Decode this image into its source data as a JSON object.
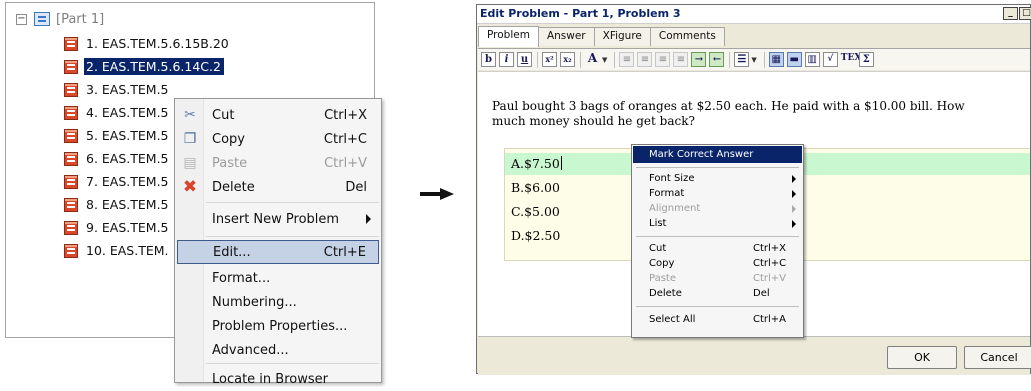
{
  "tree": {
    "root_label": "[Part 1]",
    "items": [
      {
        "label": "1. EAS.TEM.5.6.15B.20"
      },
      {
        "label": "2. EAS.TEM.5.6.14C.2",
        "selected": true
      },
      {
        "label": "3. EAS.TEM.5"
      },
      {
        "label": "4. EAS.TEM.5"
      },
      {
        "label": "5. EAS.TEM.5"
      },
      {
        "label": "6. EAS.TEM.5"
      },
      {
        "label": "7. EAS.TEM.5"
      },
      {
        "label": "8. EAS.TEM.5"
      },
      {
        "label": "9. EAS.TEM.5"
      },
      {
        "label": "10. EAS.TEM."
      }
    ]
  },
  "context_menu": {
    "items": [
      {
        "label": "Cut",
        "shortcut": "Ctrl+X",
        "icon": "scissors-icon"
      },
      {
        "label": "Copy",
        "shortcut": "Ctrl+C",
        "icon": "copy-icon"
      },
      {
        "label": "Paste",
        "shortcut": "Ctrl+V",
        "icon": "paste-icon",
        "disabled": true
      },
      {
        "label": "Delete",
        "shortcut": "Del",
        "icon": "delete-x-icon"
      },
      {
        "label": "Insert New Problem",
        "submenu": true
      },
      {
        "label": "Edit...",
        "shortcut": "Ctrl+E",
        "highlighted": true
      },
      {
        "label": "Format..."
      },
      {
        "label": "Numbering..."
      },
      {
        "label": "Problem Properties..."
      },
      {
        "label": "Advanced..."
      },
      {
        "label": "Locate in Browser"
      }
    ]
  },
  "edit_window": {
    "title": "Edit Problem - Part 1, Problem 3",
    "tabs": [
      "Problem",
      "Answer",
      "XFigure",
      "Comments"
    ],
    "active_tab": "Problem",
    "toolbar_icons": [
      "bold-icon",
      "italic-icon",
      "underline-icon",
      "superscript-icon",
      "subscript-icon",
      "font-size-icon",
      "align-left-icon",
      "align-center-icon",
      "align-right-icon",
      "justify-icon",
      "indent-icon",
      "outdent-icon",
      "list-icon",
      "table-icon",
      "image-icon",
      "graph-icon",
      "sqrt-icon",
      "tex-icon",
      "sigma-icon"
    ],
    "question": "Paul bought 3 bags of oranges at $2.50 each. He paid with a $10.00 bill. How much money should he get back?",
    "answers": [
      "A.$7.50",
      "B.$6.00",
      "C.$5.00",
      "D.$2.50"
    ],
    "buttons": {
      "ok": "OK",
      "cancel": "Cancel"
    },
    "window_buttons": {
      "minimize": "_",
      "maximize": "□",
      "close": "×"
    }
  },
  "inner_menu": {
    "items": [
      {
        "label": "Mark Correct Answer",
        "head": true
      },
      {
        "label": "Font Size",
        "submenu": true
      },
      {
        "label": "Format",
        "submenu": true
      },
      {
        "label": "Alignment",
        "submenu": true,
        "disabled": true
      },
      {
        "label": "List",
        "submenu": true
      },
      {
        "label": "Cut",
        "shortcut": "Ctrl+X"
      },
      {
        "label": "Copy",
        "shortcut": "Ctrl+C"
      },
      {
        "label": "Paste",
        "shortcut": "Ctrl+V",
        "disabled": true
      },
      {
        "label": "Delete",
        "shortcut": "Del"
      },
      {
        "label": "Select All",
        "shortcut": "Ctrl+A"
      }
    ]
  },
  "colors": {
    "selection": "#0a246a",
    "menu_highlight": "#c5d1e4",
    "correct_answer_bg": "#c9f7d0",
    "answers_bg": "#fdfde8"
  }
}
